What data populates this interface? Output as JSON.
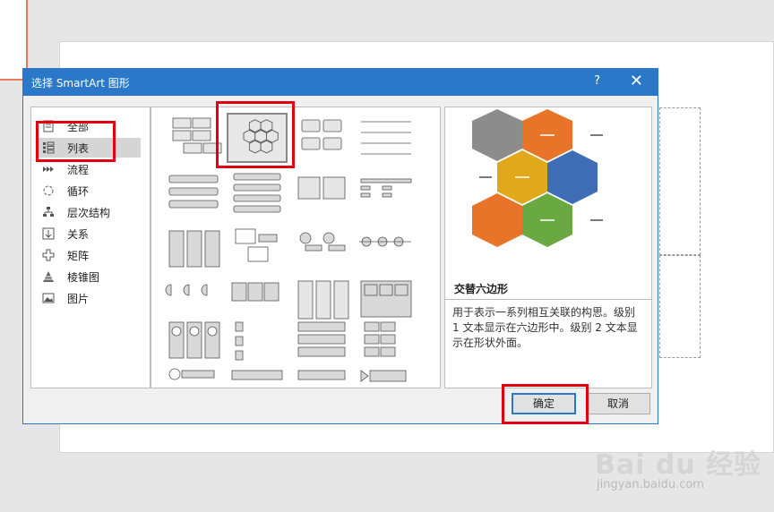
{
  "dialog": {
    "title": "选择 SmartArt 图形",
    "help": "?",
    "close": "✕",
    "ok_label": "确定",
    "cancel_label": "取消"
  },
  "categories": [
    {
      "label": "全部",
      "icon": "all-icon"
    },
    {
      "label": "列表",
      "icon": "list-icon",
      "selected": true
    },
    {
      "label": "流程",
      "icon": "process-icon"
    },
    {
      "label": "循环",
      "icon": "cycle-icon"
    },
    {
      "label": "层次结构",
      "icon": "hierarchy-icon"
    },
    {
      "label": "关系",
      "icon": "relationship-icon"
    },
    {
      "label": "矩阵",
      "icon": "matrix-icon"
    },
    {
      "label": "棱锥图",
      "icon": "pyramid-icon"
    },
    {
      "label": "图片",
      "icon": "picture-icon"
    }
  ],
  "preview": {
    "name": "交替六边形",
    "description": "用于表示一系列相互关联的构思。级别 1 文本显示在六边形中。级别 2 文本显示在形状外面。",
    "hex_colors": [
      "#8c8c8c",
      "#e8742a",
      "#e0a81a",
      "#3f6db5",
      "#e8742a",
      "#6aa842"
    ]
  },
  "watermark": {
    "brand": "Bai du 经验",
    "url": "jingyan.baidu.com"
  },
  "colors": {
    "accent": "#2b78c9",
    "highlight": "#e0000f"
  }
}
